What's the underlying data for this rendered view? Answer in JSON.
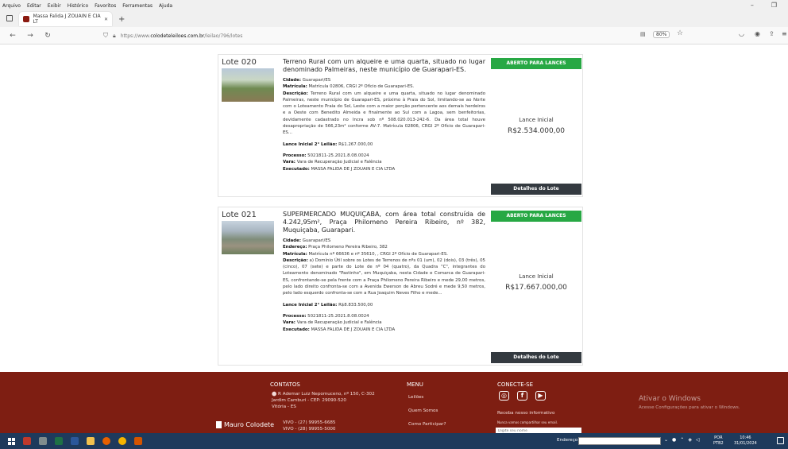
{
  "browser": {
    "menu": [
      "Arquivo",
      "Editar",
      "Exibir",
      "Histórico",
      "Favoritos",
      "Ferramentas",
      "Ajuda"
    ],
    "tab_title": "Massa Falida J ZOUAIN E CIA LT",
    "url_prefix": "https://www.",
    "url_host": "colodeteleiloes.com.br",
    "url_path": "/leilao/796/lotes",
    "zoom": "80%"
  },
  "lots": [
    {
      "number": "Lote 020",
      "title": "Terreno Rural com um alqueire e uma quarta, situado no lugar denominado Palmeiras, neste município de Guarapari-ES.",
      "cidade_label": "Cidade:",
      "cidade": "Guarapari/ES",
      "matricula_label": "Matrícula:",
      "matricula": "Matrícula 02806, CRGI 2º Ofício de Guarapari-ES.",
      "descricao_label": "Descrição:",
      "descricao": "Terreno Rural com um alqueire e uma quarta, situado no lugar denominado Palmeiras, neste município de Guarapari-ES, próximo à Praia do Sol, limitando-se ao Norte com o Loteamento Praia do Sol, Leste com a maior porção pertencente aos demais herdeiros e a Oeste com Benedito Almeida e finalmente ao Sul com a Lagoa, sem benfeitorias, devidamente cadastrado no Incra sob nº 508.020.013-242-6. Da área total houve desapropriação de 566,23m² conforme AV-7. Matrícula 02806, CRGI 2º Ofício de Guarapari-ES...",
      "lance2_label": "Lance Inicial 2° Leilão:",
      "lance2": "R$1.267.000,00",
      "processo_label": "Processo:",
      "processo": "5021811-25.2021.8.08.0024",
      "vara_label": "Vara:",
      "vara": "Vara de Recuperação Judicial e Falência",
      "executado_label": "Executado:",
      "executado": "MASSA FALIDA DE J ZOUAIN E CIA LTDA",
      "status": "ABERTO PARA LANCES",
      "lance_label": "Lance Inicial",
      "lance": "R$2.534.000,00",
      "details_button": "Detalhes do Lote"
    },
    {
      "number": "Lote 021",
      "title": "SUPERMERCADO MUQUIÇABA, com área total construída de 4.242,95m², Praça Philomeno Pereira Ribeiro, nº 382, Muquiçaba, Guarapari.",
      "cidade_label": "Cidade:",
      "cidade": "Guarapari/ES",
      "endereco_label": "Endereço:",
      "endereco": "Praça Philomeno Pereira Ribeiro, 382",
      "matricula_label": "Matrícula:",
      "matricula": "Matrícula nº 66636 e nº 35610, , CRGI 2º Ofício de Guarapari-ES.",
      "descricao_label": "Descrição:",
      "descricao": "a) Domínio Útil sobre os Lotes de Terrenos de nºs 01 (um), 02 (dois), 03 (três), 05 (cinco), 07 (sete) e parte do Lote de nº 04 (quatro), da Quadra \"C\", integrantes do Loteamento denominado \"Pastinho\", em Muquiçaba, nesta Cidade e Comarca de Guarapari-ES, confrontando-se pela frente com a Praça Philomeno Pereira Ribeiro e mede 29,00 metros, pelo lado direito confronta-se com a Avenida Ewerson de Abreu Sodré e mede 9,50 metros, pelo lado esquerdo confronta-se com a Rua Joaquim Neves Filho e mede...",
      "lance2_label": "Lance Inicial 2° Leilão:",
      "lance2": "R$8.833.500,00",
      "processo_label": "Processo:",
      "processo": "5021811-25.2021.8.08.0024",
      "vara_label": "Vara:",
      "vara": "Vara de Recuperação Judicial e Falência",
      "executado_label": "Executado:",
      "executado": "MASSA FALIDA DE J ZOUAIN E CIA LTDA",
      "status": "ABERTO PARA LANCES",
      "lance_label": "Lance Inicial",
      "lance": "R$17.667.000,00",
      "details_button": "Detalhes do Lote"
    }
  ],
  "footer": {
    "contatos_title": "CONTATOS",
    "address1": "R Ademar Luiz Nepomuceno, nº 150, C-302",
    "address2": "Jardim Camburi - CEP: 29090-520",
    "address3": "Vitória - ES",
    "phone1": "VIVO - (27) 99955-6685",
    "phone2": "VIVO - (28) 99955-5000",
    "menu_title": "MENU",
    "menu_items": [
      "Leilões",
      "Quem Somos",
      "Como Participar?"
    ],
    "conecte_title": "CONECTE-SE",
    "newsletter_label": "Receba nosso informativo",
    "newsletter_note": "Nunca vamos compartilhar seu email.",
    "newsletter_placeholder": "Digite seu nome",
    "logo_text": "Mauro Colodete",
    "watermark_title": "Ativar o Windows",
    "watermark_sub": "Acesse Configurações para ativar o Windows."
  },
  "taskbar": {
    "address_label": "Endereço",
    "lang1": "POR",
    "lang2": "PTB2",
    "time": "10:46",
    "date": "31/01/2024"
  }
}
